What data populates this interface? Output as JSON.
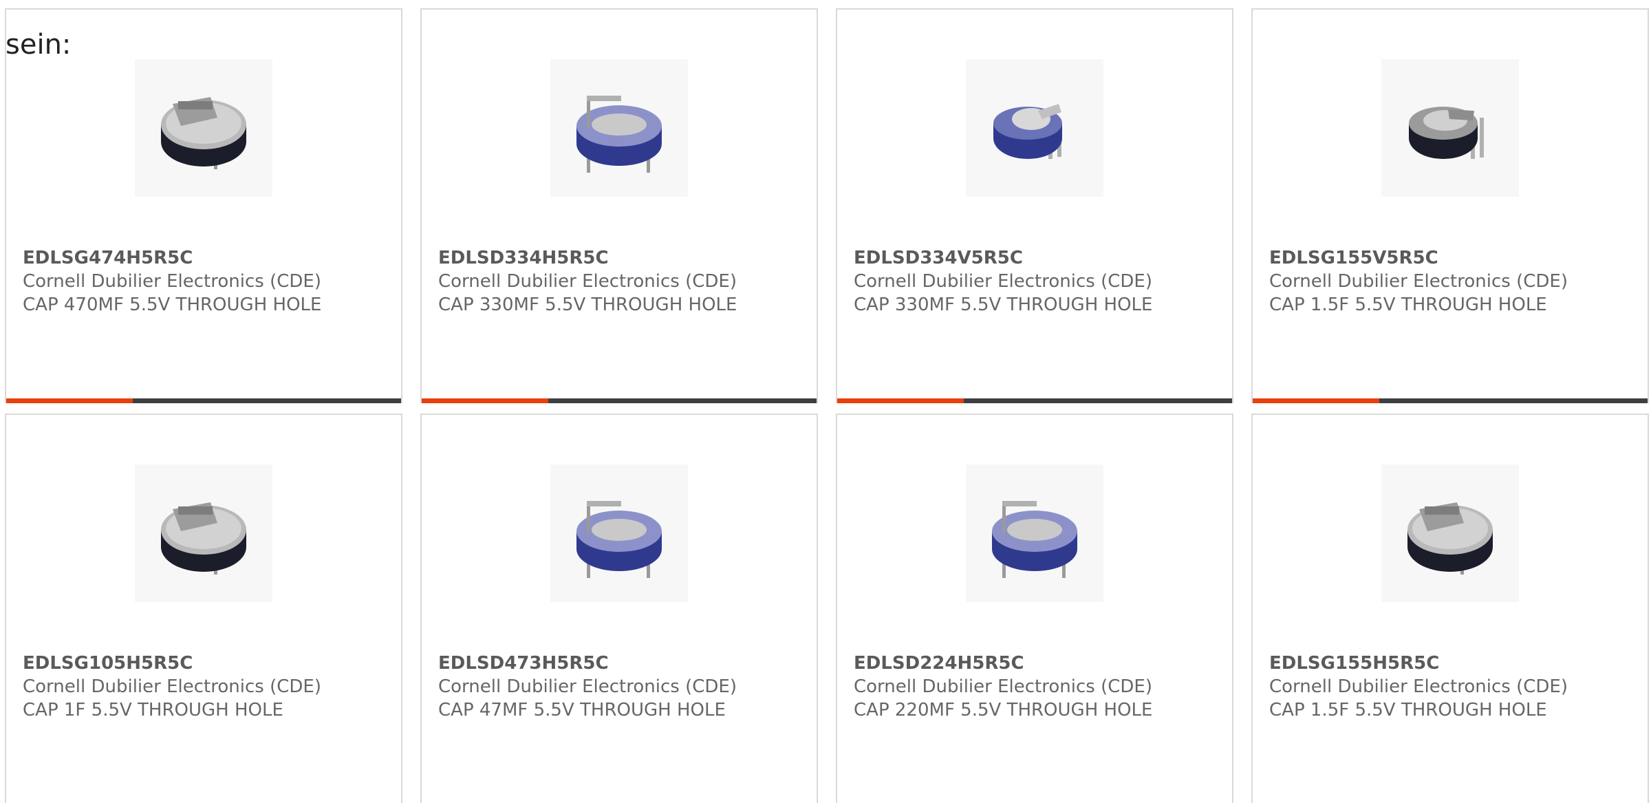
{
  "intro_text": "sein:",
  "colors": {
    "accent": "#e8410e",
    "bar": "#3d3f42",
    "border": "#d9d9d9",
    "text": "#666666",
    "capacitor_blue": "#2f3a8f",
    "capacitor_dark": "#1c1d2a"
  },
  "products": [
    {
      "part_number": "EDLSG474H5R5C",
      "manufacturer": "Cornell Dubilier Electronics (CDE)",
      "description": "CAP 470MF 5.5V THROUGH HOLE",
      "image_icon": "capacitor-dark-icon"
    },
    {
      "part_number": "EDLSD334H5R5C",
      "manufacturer": "Cornell Dubilier Electronics (CDE)",
      "description": "CAP 330MF 5.5V THROUGH HOLE",
      "image_icon": "capacitor-blue-icon"
    },
    {
      "part_number": "EDLSD334V5R5C",
      "manufacturer": "Cornell Dubilier Electronics (CDE)",
      "description": "CAP 330MF 5.5V THROUGH HOLE",
      "image_icon": "capacitor-blue-vertical-icon"
    },
    {
      "part_number": "EDLSG155V5R5C",
      "manufacturer": "Cornell Dubilier Electronics (CDE)",
      "description": "CAP 1.5F 5.5V THROUGH HOLE",
      "image_icon": "capacitor-dark-vertical-icon"
    },
    {
      "part_number": "EDLSG105H5R5C",
      "manufacturer": "Cornell Dubilier Electronics (CDE)",
      "description": "CAP 1F 5.5V THROUGH HOLE",
      "image_icon": "capacitor-dark-icon"
    },
    {
      "part_number": "EDLSD473H5R5C",
      "manufacturer": "Cornell Dubilier Electronics (CDE)",
      "description": "CAP 47MF 5.5V THROUGH HOLE",
      "image_icon": "capacitor-blue-icon"
    },
    {
      "part_number": "EDLSD224H5R5C",
      "manufacturer": "Cornell Dubilier Electronics (CDE)",
      "description": "CAP 220MF 5.5V THROUGH HOLE",
      "image_icon": "capacitor-blue-icon"
    },
    {
      "part_number": "EDLSG155H5R5C",
      "manufacturer": "Cornell Dubilier Electronics (CDE)",
      "description": "CAP 1.5F 5.5V THROUGH HOLE",
      "image_icon": "capacitor-dark-icon"
    }
  ]
}
